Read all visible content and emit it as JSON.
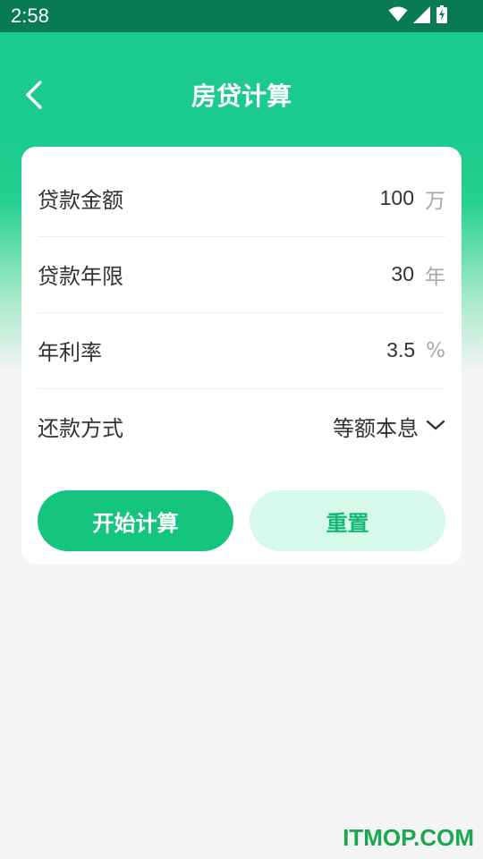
{
  "status_bar": {
    "time": "2:58",
    "icons": [
      "wifi-icon",
      "signal-icon",
      "battery-charging-icon"
    ]
  },
  "header": {
    "title": "房贷计算",
    "back_icon": "chevron-left-icon"
  },
  "form": {
    "loan_amount": {
      "label": "贷款金额",
      "value": "100",
      "unit": "万"
    },
    "loan_term": {
      "label": "贷款年限",
      "value": "30",
      "unit": "年"
    },
    "interest_rate": {
      "label": "年利率",
      "value": "3.5",
      "unit": "%"
    },
    "repayment_method": {
      "label": "还款方式",
      "value": "等额本息",
      "icon": "chevron-down-icon"
    }
  },
  "buttons": {
    "calculate": "开始计算",
    "reset": "重置"
  },
  "watermark": "ITMOP.COM",
  "colors": {
    "status_bar": "#087a54",
    "header": "#1bcb8d",
    "primary_button": "#14c47f",
    "secondary_button": "#d6f9ec",
    "secondary_button_text": "#14b877"
  }
}
